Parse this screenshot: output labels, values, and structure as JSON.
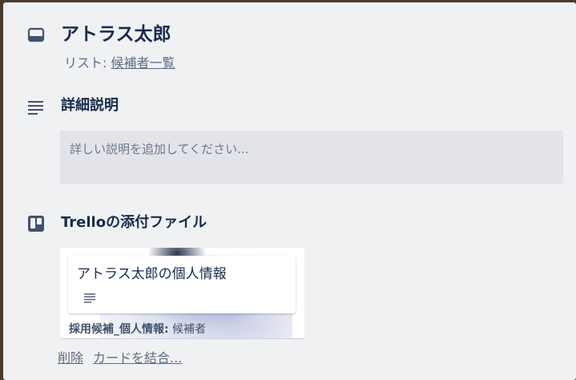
{
  "card": {
    "title": "アトラス太郎",
    "list_prefix": "リスト: ",
    "list_name": "候補者一覧"
  },
  "description": {
    "heading": "詳細説明",
    "placeholder": "詳しい説明を追加してください..."
  },
  "attachments": {
    "heading": "Trelloの添付ファイル",
    "items": [
      {
        "card_title": "アトラス太郎の個人情報",
        "board_label": "採用候補_個人情報:",
        "list_label": "候補者"
      }
    ],
    "delete_label": "削除",
    "merge_label": "カードを結合..."
  },
  "icons": {
    "card": "card-icon",
    "description": "description-lines-icon",
    "trello": "trello-board-icon",
    "mini_description": "description-lines-icon"
  },
  "colors": {
    "heading_text": "#172b4d",
    "muted_text": "#5e6c84",
    "icon": "#42526e",
    "panel_bg": "#f0f1f3",
    "input_bg": "#e2e4e9"
  }
}
